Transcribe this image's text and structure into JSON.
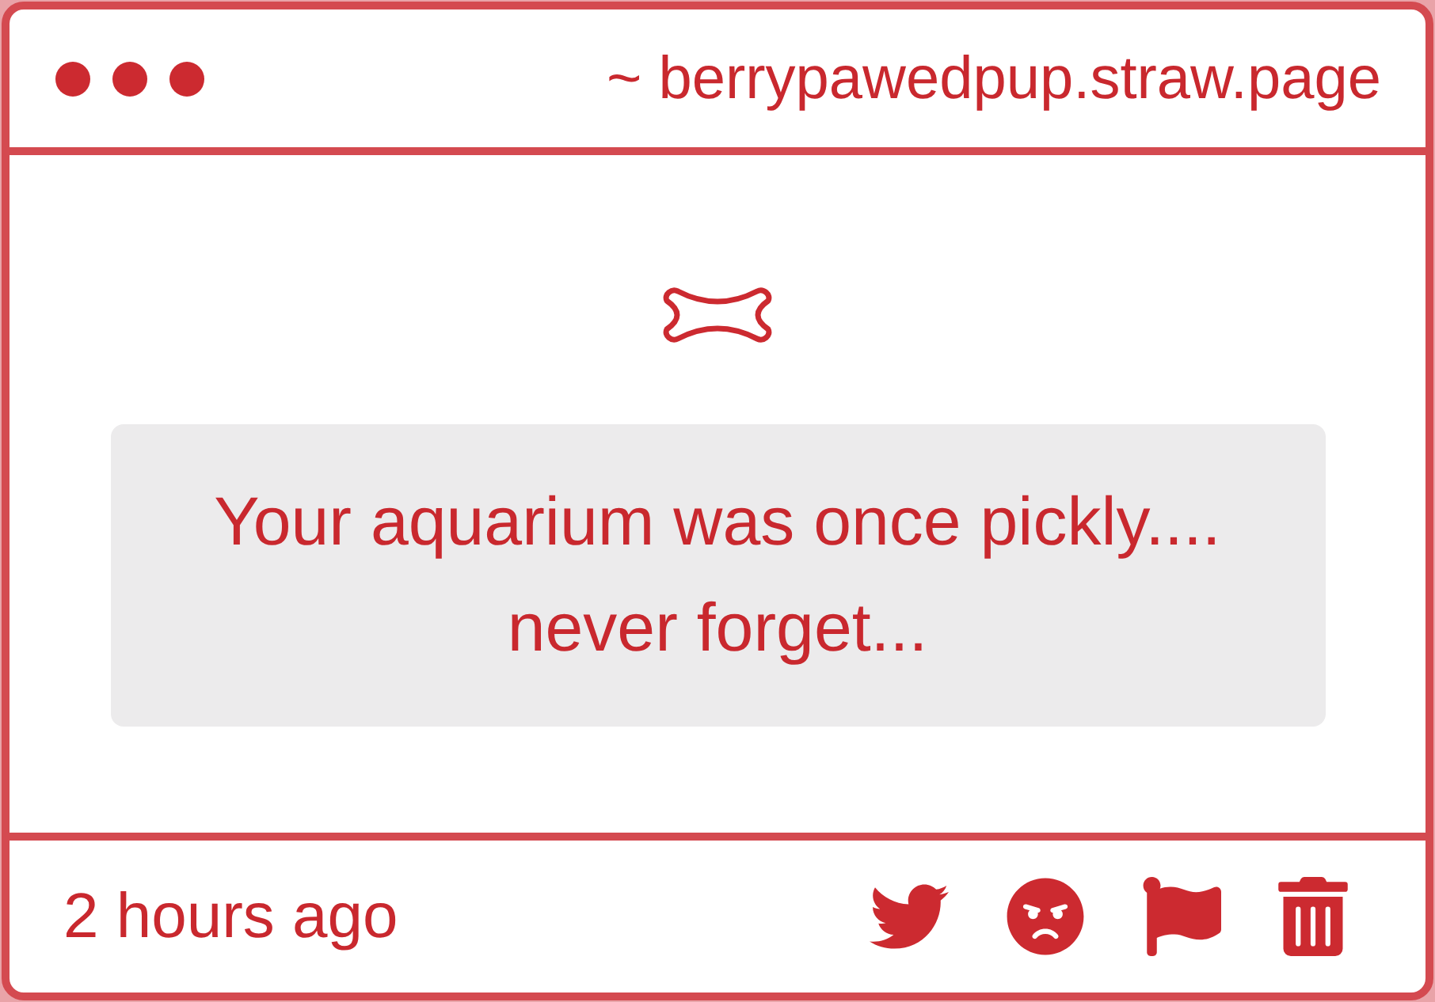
{
  "header": {
    "url": "~ berrypawedpup.straw.page"
  },
  "note": {
    "message": "Your aquarium was once pickly.... never forget..."
  },
  "footer": {
    "time": "2 hours ago",
    "actions": [
      {
        "kind": "bird"
      },
      {
        "kind": "angry"
      },
      {
        "kind": "flag"
      },
      {
        "kind": "trash"
      }
    ]
  }
}
